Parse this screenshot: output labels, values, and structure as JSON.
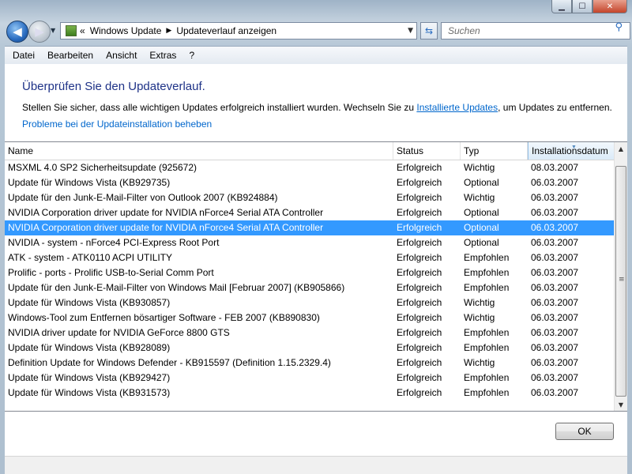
{
  "window": {
    "caption_buttons": [
      "minimize-icon",
      "maximize-icon",
      "close-icon"
    ]
  },
  "nav": {
    "back_icon": "back-arrow-icon",
    "forward_icon": "forward-arrow-icon",
    "breadcrumb_root": "«",
    "breadcrumb": [
      "Windows Update",
      "Updateverlauf anzeigen"
    ],
    "search_placeholder": "Suchen"
  },
  "menu": [
    "Datei",
    "Bearbeiten",
    "Ansicht",
    "Extras",
    "?"
  ],
  "page": {
    "heading": "Überprüfen Sie den Updateverlauf.",
    "intro_before": "Stellen Sie sicher, dass alle wichtigen Updates erfolgreich installiert wurden. Wechseln Sie zu ",
    "intro_link": "Installierte Updates",
    "intro_after": ", um Updates zu entfernen.",
    "help_link": "Probleme bei der Updateinstallation beheben"
  },
  "table": {
    "columns": [
      "Name",
      "Status",
      "Typ",
      "Installationsdatum"
    ],
    "sorted_column": "Installationsdatum",
    "rows": [
      [
        "MSXML 4.0 SP2 Sicherheitsupdate  (925672)",
        "Erfolgreich",
        "Wichtig",
        "08.03.2007"
      ],
      [
        "Update für Windows Vista (KB929735)",
        "Erfolgreich",
        "Optional",
        "06.03.2007"
      ],
      [
        "Update für den Junk-E-Mail-Filter von Outlook 2007 (KB924884)",
        "Erfolgreich",
        "Wichtig",
        "06.03.2007"
      ],
      [
        "NVIDIA Corporation driver update for NVIDIA nForce4 Serial ATA Controller",
        "Erfolgreich",
        "Optional",
        "06.03.2007"
      ],
      [
        "NVIDIA Corporation driver update for NVIDIA nForce4 Serial ATA Controller",
        "Erfolgreich",
        "Optional",
        "06.03.2007"
      ],
      [
        "NVIDIA - system - nForce4 PCI-Express Root Port",
        "Erfolgreich",
        "Optional",
        "06.03.2007"
      ],
      [
        "ATK - system - ATK0110 ACPI UTILITY",
        "Erfolgreich",
        "Empfohlen",
        "06.03.2007"
      ],
      [
        "Prolific - ports - Prolific USB-to-Serial Comm Port",
        "Erfolgreich",
        "Empfohlen",
        "06.03.2007"
      ],
      [
        "Update für den Junk-E-Mail-Filter von Windows Mail [Februar 2007] (KB905866)",
        "Erfolgreich",
        "Empfohlen",
        "06.03.2007"
      ],
      [
        "Update für Windows Vista (KB930857)",
        "Erfolgreich",
        "Wichtig",
        "06.03.2007"
      ],
      [
        "Windows-Tool zum Entfernen bösartiger Software - FEB 2007 (KB890830)",
        "Erfolgreich",
        "Wichtig",
        "06.03.2007"
      ],
      [
        "NVIDIA driver update for NVIDIA GeForce 8800 GTS",
        "Erfolgreich",
        "Empfohlen",
        "06.03.2007"
      ],
      [
        "Update für Windows Vista (KB928089)",
        "Erfolgreich",
        "Empfohlen",
        "06.03.2007"
      ],
      [
        "Definition Update for Windows Defender - KB915597 (Definition 1.15.2329.4)",
        "Erfolgreich",
        "Wichtig",
        "06.03.2007"
      ],
      [
        "Update für Windows Vista (KB929427)",
        "Erfolgreich",
        "Empfohlen",
        "06.03.2007"
      ],
      [
        "Update für Windows Vista (KB931573)",
        "Erfolgreich",
        "Empfohlen",
        "06.03.2007"
      ]
    ],
    "selected_row": 4
  },
  "buttons": {
    "ok": "OK"
  },
  "colors": {
    "selection": "#3399ff",
    "heading": "#1e3287",
    "link": "#0066cc"
  }
}
